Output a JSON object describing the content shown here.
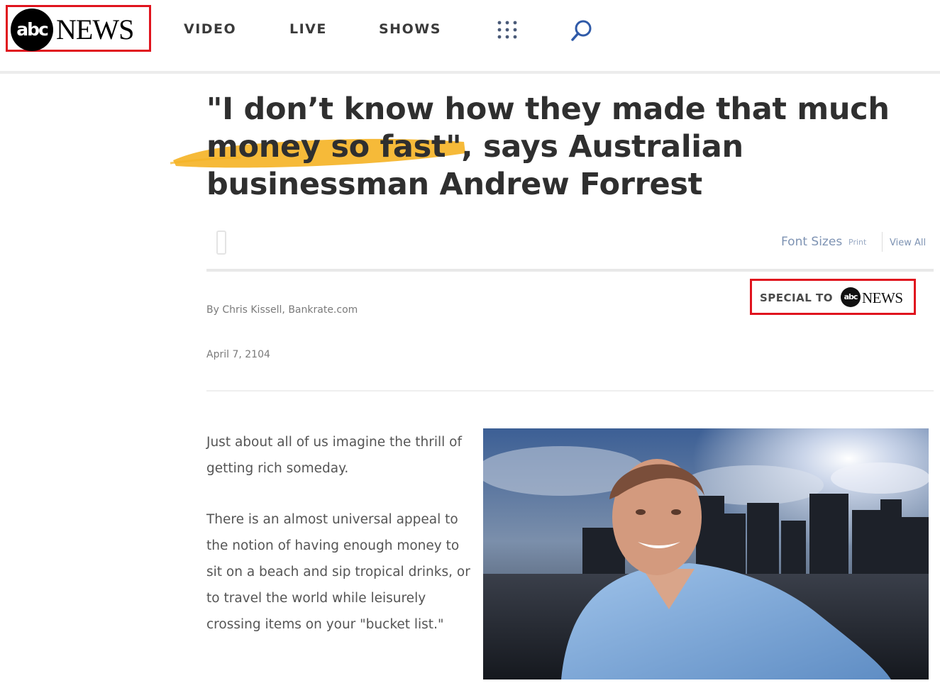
{
  "header": {
    "logo": {
      "mark": "abc",
      "wordmark": "NEWS"
    },
    "nav": [
      {
        "label": "VIDEO"
      },
      {
        "label": "LIVE"
      },
      {
        "label": "SHOWS"
      }
    ],
    "icons": [
      "grid-menu-icon",
      "search-icon"
    ]
  },
  "article": {
    "headline_pre": "\"I don’t know how they made that much ",
    "headline_highlight": "money so fast\",",
    "headline_post": " says Australian businessman Andrew Forrest",
    "toolbar": {
      "font_sizes": "Font Sizes",
      "print": "Print",
      "view_all": "View All"
    },
    "byline": "By Chris Kissell, Bankrate.com",
    "date": "April 7, 2104",
    "special": {
      "label": "SPECIAL TO",
      "mark": "abc",
      "wordmark": "NEWS"
    },
    "paragraphs": [
      "Just about all of us imagine the thrill of getting rich someday.",
      "There is an almost universal appeal to the notion of having enough money to sit on a beach and sip tropical drinks, or to travel the world while leisurely crossing items on your \"bucket list.\""
    ]
  },
  "colors": {
    "highlight": "#f5b324",
    "annotation_box": "#e0141e",
    "link": "#7e93b3"
  }
}
